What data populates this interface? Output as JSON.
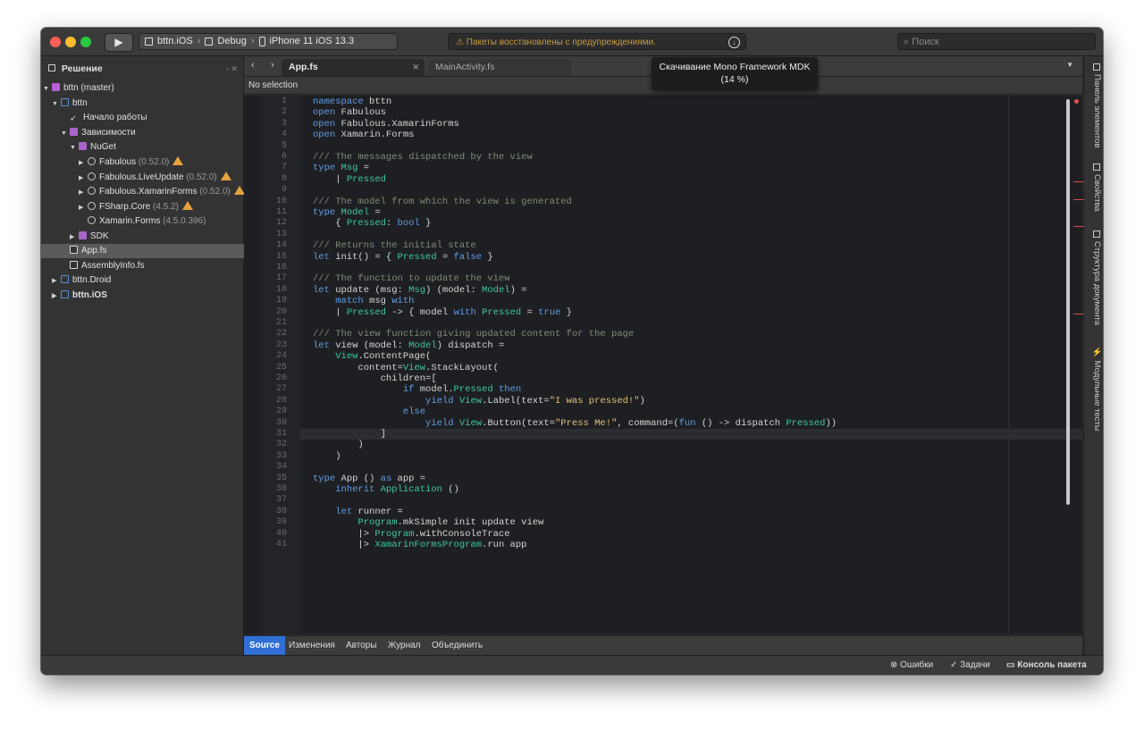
{
  "toolbar": {
    "run_icon": "play-icon",
    "config": {
      "project": "bttn.iOS",
      "configuration": "Debug",
      "device": "iPhone 11 iOS 13.3"
    },
    "status_text": "Пакеты восстановлены с предупреждениями.",
    "status_icon": "warning-icon",
    "search_placeholder": "Поиск",
    "tooltip_title": "Скачивание Mono Framework MDK",
    "tooltip_progress": "(14 %)"
  },
  "sidebar": {
    "title": "Решение",
    "items": [
      {
        "label": "bttn (master)",
        "extra": "",
        "warn": false
      },
      {
        "label": "bttn",
        "extra": "",
        "warn": false
      },
      {
        "label": "Начало работы",
        "extra": "",
        "warn": false
      },
      {
        "label": "Зависимости",
        "extra": "",
        "warn": false
      },
      {
        "label": "NuGet",
        "extra": "",
        "warn": false
      },
      {
        "label": "Fabulous",
        "extra": "(0.52.0)",
        "warn": true
      },
      {
        "label": "Fabulous.LiveUpdate",
        "extra": "(0.52.0)",
        "warn": true
      },
      {
        "label": "Fabulous.XamarinForms",
        "extra": "(0.52.0)",
        "warn": true
      },
      {
        "label": "FSharp.Core",
        "extra": "(4.5.2)",
        "warn": true
      },
      {
        "label": "Xamarin.Forms",
        "extra": "(4.5.0.396)",
        "warn": false
      },
      {
        "label": "SDK",
        "extra": "",
        "warn": false
      },
      {
        "label": "App.fs",
        "extra": "",
        "warn": false
      },
      {
        "label": "AssemblyInfo.fs",
        "extra": "",
        "warn": false
      },
      {
        "label": "bttn.Droid",
        "extra": "",
        "warn": false
      },
      {
        "label": "bttn.iOS",
        "extra": "",
        "warn": false
      }
    ]
  },
  "editor": {
    "tabs": [
      {
        "label": "App.fs"
      },
      {
        "label": "MainActivity.fs"
      }
    ],
    "path": "No selection",
    "lines": [
      "1",
      "2",
      "3",
      "4",
      "5",
      "6",
      "7",
      "8",
      "9",
      "10",
      "11",
      "12",
      "13",
      "14",
      "15",
      "16",
      "17",
      "18",
      "19",
      "20",
      "21",
      "22",
      "23",
      "24",
      "25",
      "26",
      "27",
      "28",
      "29",
      "30",
      "31",
      "32",
      "33",
      "34",
      "35",
      "36",
      "37",
      "38",
      "39",
      "40",
      "41"
    ],
    "code": [
      "namespace bttn",
      "open Fabulous",
      "open Fabulous.XamarinForms",
      "open Xamarin.Forms",
      "",
      "/// The messages dispatched by the view",
      "type Msg =",
      "    | Pressed",
      "",
      "/// The model from which the view is generated",
      "type Model =",
      "    { Pressed: bool }",
      "",
      "/// Returns the initial state",
      "let init() = { Pressed = false }",
      "",
      "/// The function to update the view",
      "let update (msg: Msg) (model: Model) =",
      "    match msg with",
      "    | Pressed -> { model with Pressed = true }",
      "",
      "/// The view function giving updated content for the page",
      "let view (model: Model) dispatch =",
      "    View.ContentPage(",
      "        content=View.StackLayout(",
      "            children=[",
      "                if model.Pressed then",
      "                    yield View.Label(text=\"I was pressed!\")",
      "                else",
      "                    yield View.Button(text=\"Press Me!\", command=(fun () -> dispatch Pressed))",
      "            ]",
      "        )",
      "    )",
      "",
      "type App () as app =",
      "    inherit Application ()",
      "",
      "    let runner =",
      "        Program.mkSimple init update view",
      "        |> Program.withConsoleTrace",
      "        |> XamarinFormsProgram.run app"
    ]
  },
  "bottom_tabs": [
    "Source",
    "Изменения",
    "Авторы",
    "Журнал",
    "Объединить"
  ],
  "right_pane": [
    "Панель элементов",
    "Свойства",
    "Структура документа",
    "Модульные тесты"
  ],
  "statusbar": {
    "errors": "Ошибки",
    "tasks": "Задачи",
    "console": "Консоль пакета"
  },
  "colors": {
    "keyword": "#5f9ee8",
    "type": "#3fc7a5",
    "comment": "#7f8c7a",
    "string": "#e8c17a",
    "accent": "#2f6fd6",
    "warning": "#e6a23c"
  }
}
